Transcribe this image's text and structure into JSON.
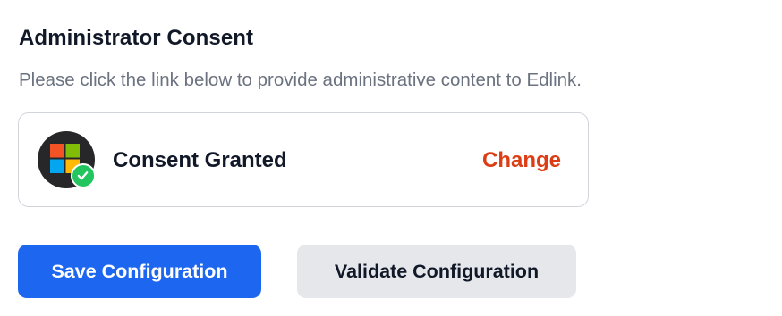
{
  "section": {
    "title": "Administrator Consent",
    "description": "Please click the link below to provide administrative content to Edlink."
  },
  "consent": {
    "provider_icon": "microsoft-logo",
    "badge_icon": "check-circle-icon",
    "status_label": "Consent Granted",
    "change_label": "Change"
  },
  "actions": {
    "save_label": "Save Configuration",
    "validate_label": "Validate Configuration"
  },
  "colors": {
    "primary": "#1d66f0",
    "danger_link": "#dc3d14",
    "success": "#22c55e",
    "secondary_bg": "#e5e7eb",
    "microsoft_red": "#f35325",
    "microsoft_green": "#81bc06",
    "microsoft_blue": "#05a6f0",
    "microsoft_yellow": "#ffba08"
  }
}
